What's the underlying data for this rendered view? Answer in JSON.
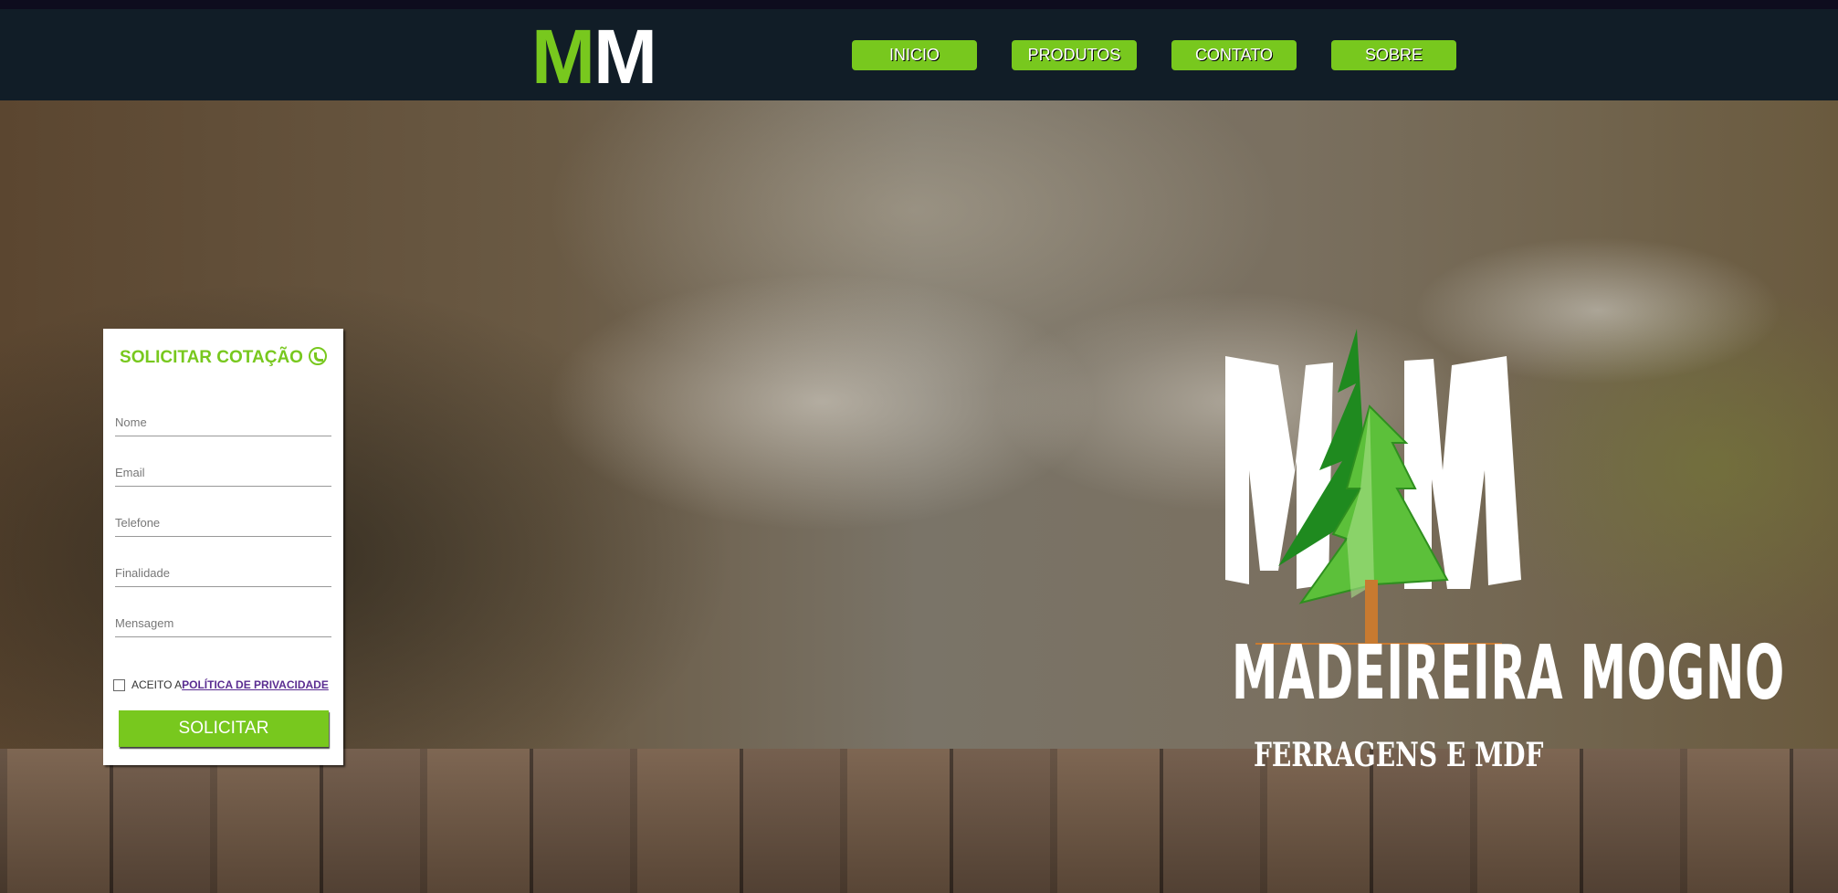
{
  "header": {
    "brand_green": "M",
    "brand_white": "M",
    "nav": [
      "INICIO",
      "PRODUTOS",
      "CONTATO",
      "SOBRE"
    ]
  },
  "form": {
    "title": "SOLICITAR COTAÇÃO",
    "title_icon": "whatsapp-icon",
    "fields": [
      {
        "placeholder": "Nome",
        "value": ""
      },
      {
        "placeholder": "Email",
        "value": ""
      },
      {
        "placeholder": "Telefone",
        "value": ""
      },
      {
        "placeholder": "Finalidade",
        "value": ""
      },
      {
        "placeholder": "Mensagem",
        "value": ""
      }
    ],
    "consent_prefix": "ACEITO A",
    "consent_link": "POLÍTICA DE PRIVACIDADE",
    "consent_checked": false,
    "submit": "SOLICITAR"
  },
  "hero_logo": {
    "letters": "MM",
    "name": "MADEIREIRA MOGNO",
    "tagline": "FERRAGENS E MDF"
  },
  "colors": {
    "accent": "#78c81e",
    "header_bg": "#111d27",
    "link": "#5a2d91"
  }
}
